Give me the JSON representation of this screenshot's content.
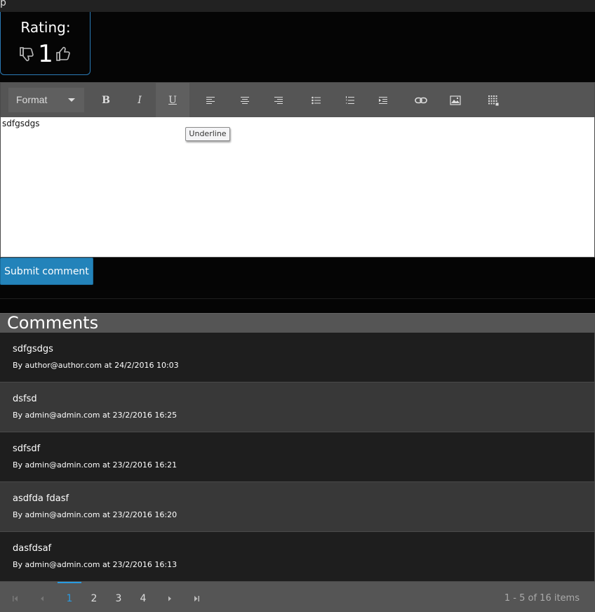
{
  "topbar": {
    "stub": "p"
  },
  "rating": {
    "label": "Rating:",
    "value": "1"
  },
  "editor": {
    "format_label": "Format",
    "content": "sdfgsdgs",
    "tooltip": "Underline",
    "buttons": {
      "bold": "B",
      "italic": "I",
      "underline": "U"
    }
  },
  "submit_label": "Submit comment",
  "comments": {
    "title": "Comments",
    "items": [
      {
        "title": "sdfgsdgs",
        "meta": "By author@author.com at 24/2/2016 10:03"
      },
      {
        "title": "dsfsd",
        "meta": "By admin@admin.com at 23/2/2016 16:25"
      },
      {
        "title": "sdfsdf",
        "meta": "By admin@admin.com at 23/2/2016 16:21"
      },
      {
        "title": "asdfda fdasf",
        "meta": "By admin@admin.com at 23/2/2016 16:20"
      },
      {
        "title": "dasfdsaf",
        "meta": "By admin@admin.com at 23/2/2016 16:13"
      }
    ]
  },
  "pager": {
    "pages": [
      "1",
      "2",
      "3",
      "4"
    ],
    "current": "1",
    "info": "1 - 5 of 16 items"
  },
  "colors": {
    "accent": "#2383ba",
    "active_page": "#2a9be0",
    "toolbar": "#555555"
  }
}
